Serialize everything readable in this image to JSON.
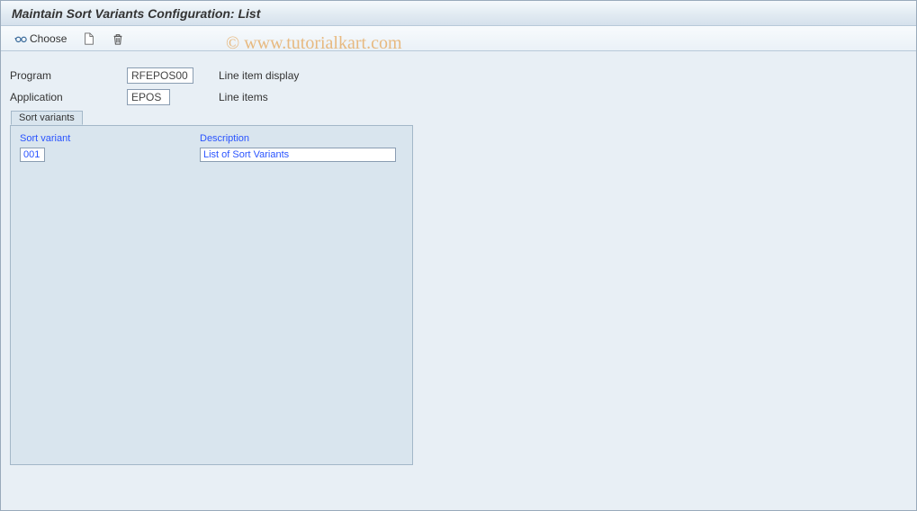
{
  "header": {
    "title": "Maintain Sort Variants Configuration: List"
  },
  "toolbar": {
    "choose_label": "Choose"
  },
  "fields": {
    "program": {
      "label": "Program",
      "value": "RFEPOS00",
      "desc": "Line item display"
    },
    "application": {
      "label": "Application",
      "value": "EPOS",
      "desc": "Line items"
    }
  },
  "panel": {
    "title": "Sort variants",
    "columns": {
      "variant": "Sort variant",
      "description": "Description"
    },
    "rows": [
      {
        "variant": "001",
        "description": "List of Sort Variants"
      }
    ]
  },
  "watermark": "© www.tutorialkart.com"
}
